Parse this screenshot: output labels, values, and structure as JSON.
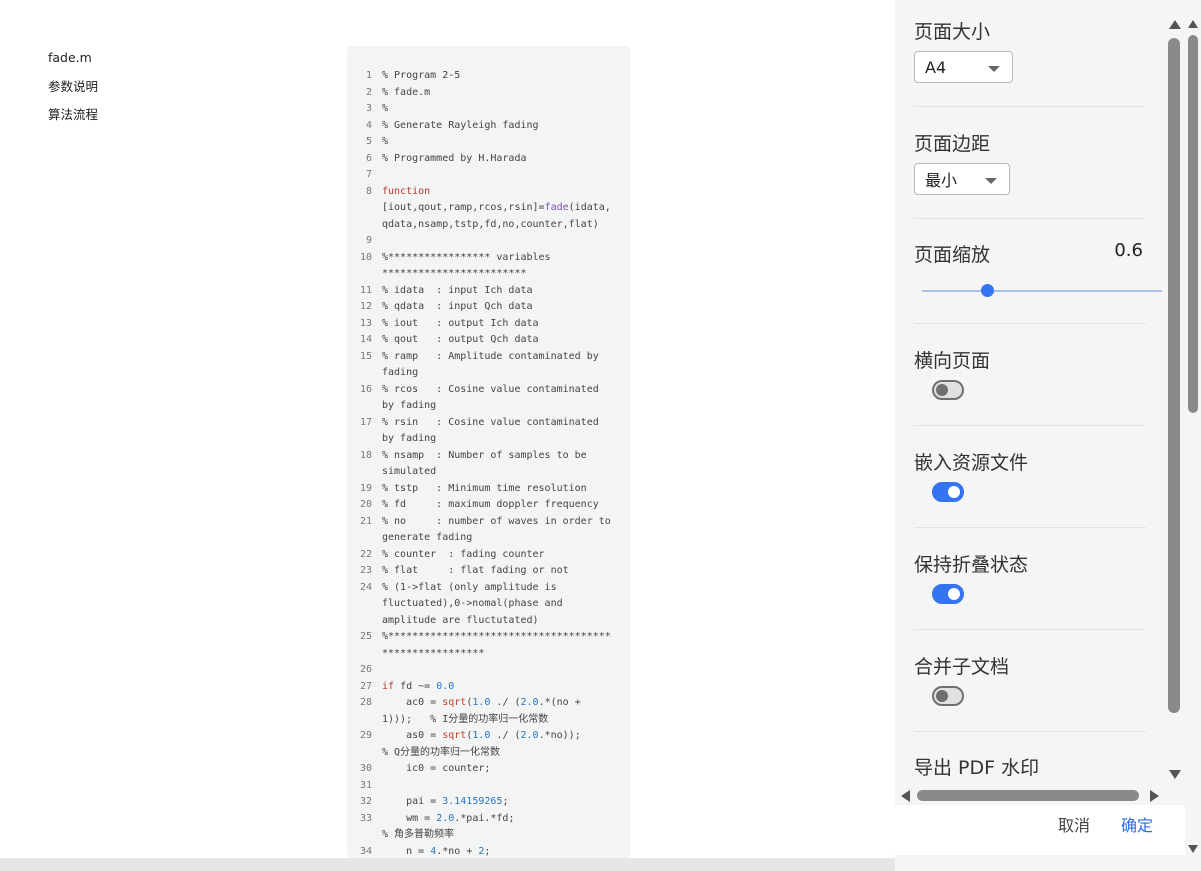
{
  "toc": {
    "items": [
      "fade.m",
      "参数说明",
      "算法流程"
    ]
  },
  "code_lines": [
    {
      "n": "1",
      "h": "% Program 2-5"
    },
    {
      "n": "2",
      "h": "% fade.m"
    },
    {
      "n": "3",
      "h": "%"
    },
    {
      "n": "4",
      "h": "% Generate Rayleigh fading"
    },
    {
      "n": "5",
      "h": "%"
    },
    {
      "n": "6",
      "h": "% Programmed by H.Harada"
    },
    {
      "n": "7",
      "h": ""
    },
    {
      "n": "8",
      "h": "<span class=\"k\">function</span>\n[iout,qout,ramp,rcos,rsin]=<span class=\"fn\">fade</span>(idata,\nqdata,nsamp,tstp,fd,no,counter,flat)"
    },
    {
      "n": "9",
      "h": ""
    },
    {
      "n": "10",
      "h": "%***************** variables\n************************"
    },
    {
      "n": "11",
      "h": "% idata  : input Ich data"
    },
    {
      "n": "12",
      "h": "% qdata  : input Qch data"
    },
    {
      "n": "13",
      "h": "% iout   : output Ich data"
    },
    {
      "n": "14",
      "h": "% qout   : output Qch data"
    },
    {
      "n": "15",
      "h": "% ramp   : Amplitude contaminated by\nfading"
    },
    {
      "n": "16",
      "h": "% rcos   : Cosine value contaminated\nby fading"
    },
    {
      "n": "17",
      "h": "% rsin   : Cosine value contaminated\nby fading"
    },
    {
      "n": "18",
      "h": "% nsamp  : Number of samples to be\nsimulated"
    },
    {
      "n": "19",
      "h": "% tstp   : Minimum time resolution"
    },
    {
      "n": "20",
      "h": "% fd     : maximum doppler frequency"
    },
    {
      "n": "21",
      "h": "% no     : number of waves in order to\ngenerate fading"
    },
    {
      "n": "22",
      "h": "% counter  : fading counter"
    },
    {
      "n": "23",
      "h": "% flat     : flat fading or not"
    },
    {
      "n": "24",
      "h": "% (1->flat (only amplitude is\nfluctuated),0->nomal(phase and\namplitude are fluctutated)"
    },
    {
      "n": "25",
      "h": "%*************************************\n*****************"
    },
    {
      "n": "26",
      "h": ""
    },
    {
      "n": "27",
      "h": "<span class=\"k\">if</span> fd ~= <span class=\"n\">0.0</span>"
    },
    {
      "n": "28",
      "h": "    ac0 = <span class=\"f\">sqrt</span>(<span class=\"n\">1.0</span> ./ (<span class=\"n\">2.0</span>.*(no +\n1)));   % I分量的功率归一化常数"
    },
    {
      "n": "29",
      "h": "    as0 = <span class=\"f\">sqrt</span>(<span class=\"n\">1.0</span> ./ (<span class=\"n\">2.0</span>.*no));\n% Q分量的功率归一化常数"
    },
    {
      "n": "30",
      "h": "    ic0 = counter;"
    },
    {
      "n": "31",
      "h": ""
    },
    {
      "n": "32",
      "h": "    pai = <span class=\"n\">3.14159265</span>;"
    },
    {
      "n": "33",
      "h": "    wm = <span class=\"n\">2.0</span>.*pai.*fd;\n% 角多普勒频率"
    },
    {
      "n": "34",
      "h": "    n = <span class=\"n\">4</span>.*no + <span class=\"n\">2</span>;"
    }
  ],
  "settings": {
    "page_size": {
      "label": "页面大小",
      "value": "A4"
    },
    "page_margin": {
      "label": "页面边距",
      "value": "最小"
    },
    "page_zoom": {
      "label": "页面缩放",
      "value": "0.6",
      "fraction": 0.27
    },
    "landscape": {
      "label": "横向页面",
      "on": false
    },
    "embed_resources": {
      "label": "嵌入资源文件",
      "on": true
    },
    "keep_collapsed": {
      "label": "保持折叠状态",
      "on": true
    },
    "merge_subdocs": {
      "label": "合并子文档",
      "on": false
    },
    "pdf_watermark": {
      "label": "导出 PDF 水印"
    }
  },
  "footer": {
    "cancel": "取消",
    "ok": "确定"
  }
}
